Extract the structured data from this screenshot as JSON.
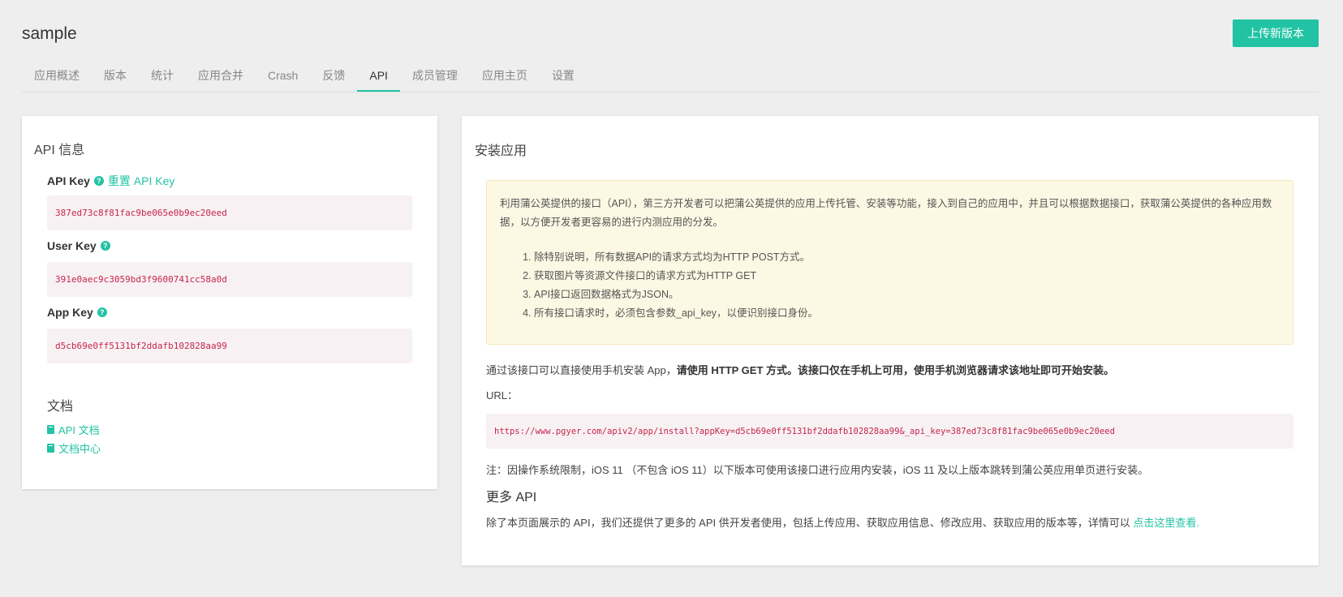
{
  "header": {
    "app_name": "sample",
    "upload_button": "上传新版本"
  },
  "tabs": [
    {
      "label": "应用概述"
    },
    {
      "label": "版本"
    },
    {
      "label": "统计"
    },
    {
      "label": "应用合并"
    },
    {
      "label": "Crash"
    },
    {
      "label": "反馈"
    },
    {
      "label": "API",
      "active": true
    },
    {
      "label": "成员管理"
    },
    {
      "label": "应用主页"
    },
    {
      "label": "设置"
    }
  ],
  "api_info": {
    "title": "API 信息",
    "api_key_label": "API Key",
    "reset_label": "重置 API Key",
    "api_key": "387ed73c8f81fac9be065e0b9ec20eed",
    "user_key_label": "User Key",
    "user_key": "391e0aec9c3059bd3f9600741cc58a0d",
    "app_key_label": "App Key",
    "app_key": "d5cb69e0ff5131bf2ddafb102828aa99",
    "docs_title": "文档",
    "doc_links": [
      "API 文档",
      "文档中心"
    ]
  },
  "install": {
    "title": "安装应用",
    "notice_intro": "利用蒲公英提供的接口（API），第三方开发者可以把蒲公英提供的应用上传托管、安装等功能，接入到自己的应用中，并且可以根据数据接口，获取蒲公英提供的各种应用数据，以方便开发者更容易的进行内测应用的分发。",
    "notice_items": [
      "除特别说明，所有数据API的请求方式均为HTTP POST方式。",
      "获取图片等资源文件接口的请求方式为HTTP GET",
      "API接口返回数据格式为JSON。",
      "所有接口请求时，必须包含参数_api_key，以便识别接口身份。"
    ],
    "desc_normal": "通过该接口可以直接使用手机安装 App，",
    "desc_bold": "请使用 HTTP GET 方式。该接口仅在手机上可用，使用手机浏览器请求该地址即可开始安装。",
    "url_label": "URL：",
    "url": "https://www.pgyer.com/apiv2/app/install?appKey=d5cb69e0ff5131bf2ddafb102828aa99&_api_key=387ed73c8f81fac9be065e0b9ec20eed",
    "note": "注：因操作系统限制，iOS 11 （不包含 iOS 11）以下版本可使用该接口进行应用内安装，iOS 11 及以上版本跳转到蒲公英应用单页进行安装。",
    "more_title": "更多 API",
    "more_desc": "除了本页面展示的 API，我们还提供了更多的 API 供开发者使用，包括上传应用、获取应用信息、修改应用、获取应用的版本等，详情可以 ",
    "more_link": "点击这里查看."
  },
  "colors": {
    "accent": "#22c3a4",
    "code_text": "#c7254e",
    "code_bg": "#f7f1f3",
    "notice_bg": "#fcf8e3"
  }
}
